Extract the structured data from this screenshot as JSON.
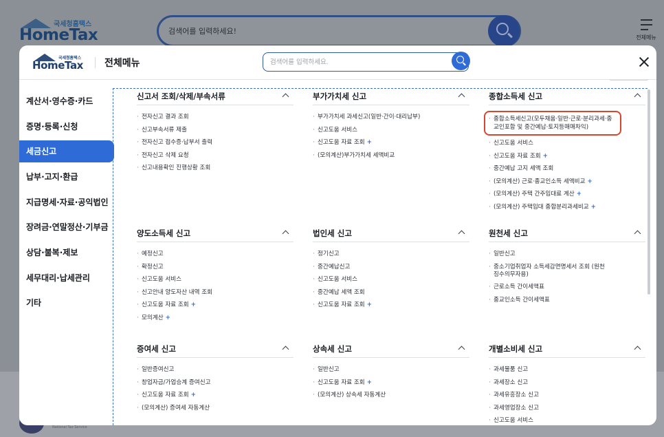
{
  "background": {
    "logo_ko": "국세청홈택스",
    "logo_en": "HomeTax",
    "search_placeholder": "검색어를 입력하세요!",
    "all_menu_label": "전체메뉴",
    "footer_text": "National Tax Service"
  },
  "modal": {
    "logo_ko": "국세청홈택스",
    "logo_en": "HomeTax",
    "title": "전체메뉴",
    "search_placeholder": "검색어를 입력하세요.",
    "sidebar": [
      {
        "label": "계산서·영수증·카드"
      },
      {
        "label": "증명·등록·신청"
      },
      {
        "label": "세금신고"
      },
      {
        "label": "납부·고지·환급"
      },
      {
        "label": "지급명세·자료·공익법인"
      },
      {
        "label": "장려금·연말정산·기부금"
      },
      {
        "label": "상담·불복·제보"
      },
      {
        "label": "세무대리·납세관리"
      },
      {
        "label": "기타"
      }
    ],
    "sidebar_active_index": 2,
    "sections": [
      {
        "title": "신고서 조회/삭제/부속서류",
        "items": [
          "전자신고 결과 조회",
          "신고부속서류 제출",
          "전자신고 접수증·납부서 출력",
          "전자신고 삭제 요청",
          "신고내용확인 진행상황 조회"
        ]
      },
      {
        "title": "부가가치세 신고",
        "items": [
          "부가가치세 과세신고(일반·간이·대리납부)",
          "신고도움 서비스",
          "신고도움 자료 조회",
          "(모의계산)부가가치세 세액비교"
        ]
      },
      {
        "title": "종합소득세 신고",
        "items": [
          "종합소득세신고(모두채움·일반·근로·분리과세·종교인포함 및 중간예납·토지등매매차익)",
          "신고도움 서비스",
          "신고도움 자료 조회",
          "중간예납 고지 세액 조회",
          "(모의계산) 근로·종교인소득 세액비교",
          "(모의계산) 주택 간주임대료 계산",
          "(모의계산) 주택임대 종합분리과세비교"
        ]
      },
      {
        "title": "양도소득세 신고",
        "items": [
          "예정신고",
          "확정신고",
          "신고도움 서비스",
          "신고안내 양도자산 내역 조회",
          "신고도움 자료 조회",
          "모의계산"
        ]
      },
      {
        "title": "법인세 신고",
        "items": [
          "정기신고",
          "중간예납신고",
          "신고도움 서비스",
          "중간예납 세액 조회",
          "신고도움 자료 조회"
        ]
      },
      {
        "title": "원천세 신고",
        "items": [
          "일반신고",
          "중소기업취업자 소득세감면명세서 조회 (원천징수의무자용)",
          "근로소득 간이세액표",
          "종교인소득 간이세액표"
        ]
      },
      {
        "title": "증여세 신고",
        "items": [
          "일반증여신고",
          "창업자금/가업승계 증여신고",
          "신고도움 자료 조회",
          "(모의계산) 증여세 자동계산"
        ]
      },
      {
        "title": "상속세 신고",
        "items": [
          "일반신고",
          "신고도움 자료 조회",
          "(모의계산) 상속세 자동계산"
        ]
      },
      {
        "title": "개별소비세 신고",
        "items": [
          "과세물품 신고",
          "과세장소 신고",
          "과세유흥장소 신고",
          "과세영업장소 신고",
          "신고도움 서비스"
        ]
      }
    ],
    "plus_symbol": "+"
  }
}
